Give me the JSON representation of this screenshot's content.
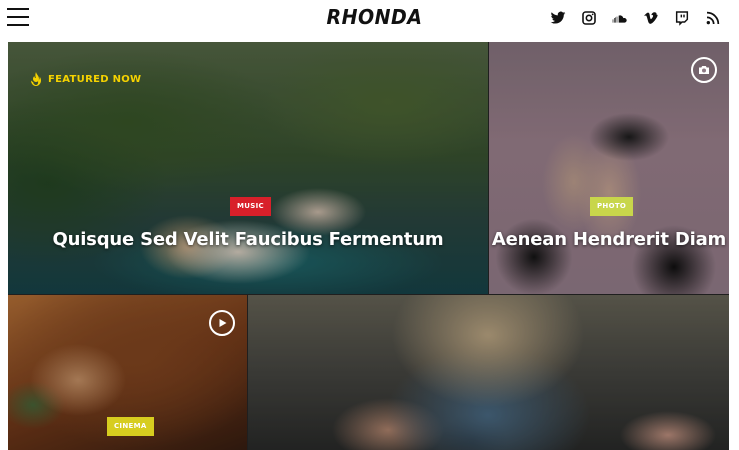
{
  "header": {
    "logo": "RHONDA",
    "menu_icon": "hamburger-menu-icon",
    "social": [
      {
        "name": "twitter-icon"
      },
      {
        "name": "instagram-icon"
      },
      {
        "name": "soundcloud-icon"
      },
      {
        "name": "vimeo-icon"
      },
      {
        "name": "twitch-icon"
      },
      {
        "name": "rss-icon"
      }
    ]
  },
  "featured": {
    "label": "FEATURED NOW",
    "icon": "flame-icon",
    "color": "#f5d200"
  },
  "posts": [
    {
      "category": "MUSIC",
      "title": "Quisque Sed Velit Faucibus Fermentum",
      "category_color": "#d8202a"
    },
    {
      "category": "PHOTO",
      "title": "Aenean Hendrerit Diam",
      "category_color": "#c8d64b",
      "format_icon": "camera-icon"
    },
    {
      "category": "CINEMA",
      "title": "",
      "category_color": "#d7cd1f",
      "format_icon": "play-icon"
    },
    {
      "category": "",
      "title": ""
    }
  ]
}
